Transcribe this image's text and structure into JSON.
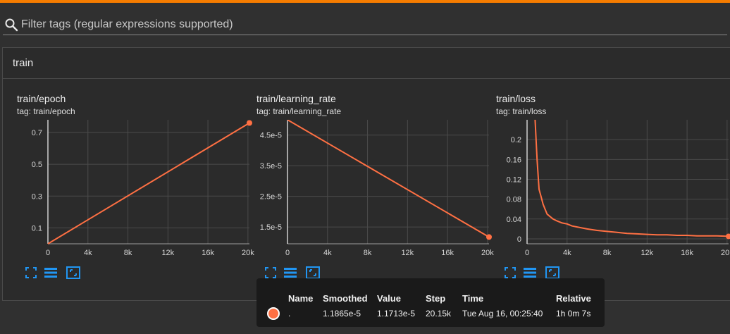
{
  "filter": {
    "placeholder": "Filter tags (regular expressions supported)"
  },
  "section": {
    "title": "train"
  },
  "colors": {
    "accent": "#f57c00",
    "series": "#ff7043",
    "icon": "#2196f3"
  },
  "cards": [
    {
      "title": "train/epoch",
      "tag": "tag: train/epoch"
    },
    {
      "title": "train/learning_rate",
      "tag": "tag: train/learning_rate"
    },
    {
      "title": "train/loss",
      "tag": "tag: train/loss"
    }
  ],
  "card_tools": [
    "fit-domain-icon",
    "toggle-log-scale-icon",
    "expand-chart-icon"
  ],
  "chart_data": [
    {
      "type": "line",
      "title": "train/epoch",
      "xlim": [
        0,
        20150
      ],
      "ylim": [
        0,
        0.78
      ],
      "x_ticks": [
        0,
        4000,
        8000,
        12000,
        16000,
        20000
      ],
      "x_tick_labels": [
        "0",
        "4k",
        "8k",
        "12k",
        "16k",
        "20k"
      ],
      "y_ticks": [
        0.1,
        0.3,
        0.5,
        0.7
      ],
      "y_tick_labels": [
        "0.1",
        "0.3",
        "0.5",
        "0.7"
      ],
      "grid": true,
      "series": [
        {
          "x": [
            0,
            20150
          ],
          "y": [
            0,
            0.76
          ]
        }
      ]
    },
    {
      "type": "line",
      "title": "train/learning_rate",
      "xlim": [
        0,
        20150
      ],
      "ylim": [
        9.5e-06,
        5e-05
      ],
      "x_ticks": [
        0,
        4000,
        8000,
        12000,
        16000,
        20000
      ],
      "x_tick_labels": [
        "0",
        "4k",
        "8k",
        "12k",
        "16k",
        "20k"
      ],
      "y_ticks": [
        1.5e-05,
        2.5e-05,
        3.5e-05,
        4.5e-05
      ],
      "y_tick_labels": [
        "1.5e-5",
        "2.5e-5",
        "3.5e-5",
        "4.5e-5"
      ],
      "grid": true,
      "series": [
        {
          "x": [
            0,
            20150
          ],
          "y": [
            5e-05,
            1.1713e-05
          ]
        }
      ]
    },
    {
      "type": "line",
      "title": "train/loss",
      "xlim": [
        0,
        20150
      ],
      "ylim": [
        -0.01,
        0.24
      ],
      "x_ticks": [
        0,
        4000,
        8000,
        12000,
        16000,
        20000
      ],
      "x_tick_labels": [
        "0",
        "4k",
        "8k",
        "12k",
        "16k",
        "20k"
      ],
      "y_ticks": [
        0,
        0.04,
        0.08,
        0.12,
        0.16,
        0.2
      ],
      "y_tick_labels": [
        "0",
        "0.04",
        "0.08",
        "0.12",
        "0.16",
        "0.2"
      ],
      "grid": true,
      "series": [
        {
          "x": [
            800,
            900,
            1000,
            1100,
            1200,
            1400,
            1600,
            1800,
            2000,
            2300,
            2600,
            3000,
            3500,
            4000,
            4500,
            5000,
            6000,
            7000,
            8000,
            9000,
            10000,
            11000,
            12000,
            13000,
            14000,
            15000,
            16000,
            17000,
            18000,
            19000,
            20150
          ],
          "y": [
            0.24,
            0.2,
            0.16,
            0.13,
            0.1,
            0.085,
            0.07,
            0.06,
            0.05,
            0.045,
            0.04,
            0.036,
            0.032,
            0.03,
            0.026,
            0.024,
            0.02,
            0.017,
            0.015,
            0.013,
            0.011,
            0.01,
            0.009,
            0.008,
            0.008,
            0.007,
            0.007,
            0.006,
            0.006,
            0.006,
            0.005
          ]
        }
      ]
    }
  ],
  "tooltip": {
    "headers": {
      "name": "Name",
      "smoothed": "Smoothed",
      "value": "Value",
      "step": "Step",
      "time": "Time",
      "relative": "Relative"
    },
    "row": {
      "name": ".",
      "smoothed": "1.1865e-5",
      "value": "1.1713e-5",
      "step": "20.15k",
      "time": "Tue Aug 16, 00:25:40",
      "relative": "1h 0m 7s"
    }
  }
}
